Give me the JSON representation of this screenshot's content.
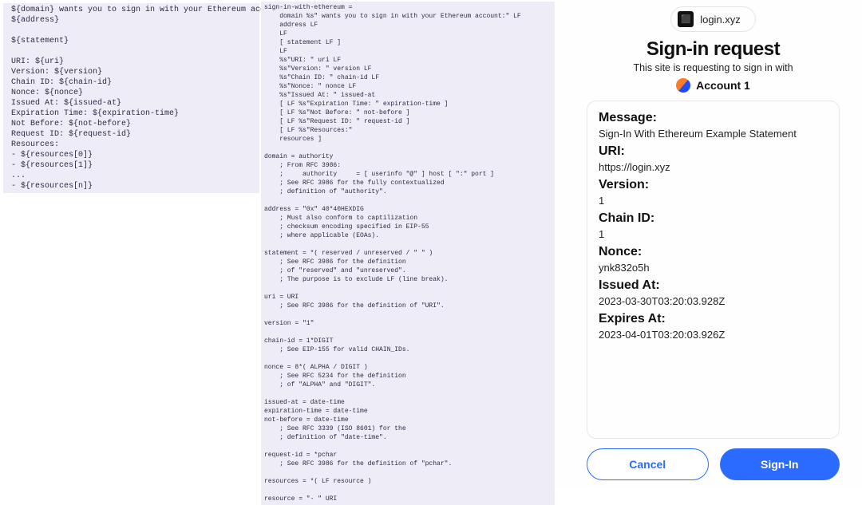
{
  "template": {
    "text": " ${domain} wants you to sign in with your Ethereum account:\n ${address}\n\n ${statement}\n\n URI: ${uri}\n Version: ${version}\n Chain ID: ${chain-id}\n Nonce: ${nonce}\n Issued At: ${issued-at}\n Expiration Time: ${expiration-time}\n Not Before: ${not-before}\n Request ID: ${request-id}\n Resources:\n - ${resources[0]}\n - ${resources[1]}\n ...\n - ${resources[n]}"
  },
  "abnf": {
    "text": "sign-in-with-ethereum =\n    domain %s\" wants you to sign in with your Ethereum account:\" LF\n    address LF\n    LF\n    [ statement LF ]\n    LF\n    %s\"URI: \" uri LF\n    %s\"Version: \" version LF\n    %s\"Chain ID: \" chain-id LF\n    %s\"Nonce: \" nonce LF\n    %s\"Issued At: \" issued-at\n    [ LF %s\"Expiration Time: \" expiration-time ]\n    [ LF %s\"Not Before: \" not-before ]\n    [ LF %s\"Request ID: \" request-id ]\n    [ LF %s\"Resources:\"\n    resources ]\n\ndomain = authority\n    ; From RFC 3986:\n    ;     authority     = [ userinfo \"@\" ] host [ \":\" port ]\n    ; See RFC 3986 for the fully contextualized\n    ; definition of \"authority\".\n\naddress = \"0x\" 40*40HEXDIG\n    ; Must also conform to captilization\n    ; checksum encoding specified in EIP-55\n    ; where applicable (EOAs).\n\nstatement = *( reserved / unreserved / \" \" )\n    ; See RFC 3986 for the definition\n    ; of \"reserved\" and \"unreserved\".\n    ; The purpose is to exclude LF (line break).\n\nuri = URI\n    ; See RFC 3986 for the definition of \"URI\".\n\nversion = \"1\"\n\nchain-id = 1*DIGIT\n    ; See EIP-155 for valid CHAIN_IDs.\n\nnonce = 8*( ALPHA / DIGIT )\n    ; See RFC 5234 for the definition\n    ; of \"ALPHA\" and \"DIGIT\".\n\nissued-at = date-time\nexpiration-time = date-time\nnot-before = date-time\n    ; See RFC 3339 (ISO 8601) for the\n    ; definition of \"date-time\".\n\nrequest-id = *pchar\n    ; See RFC 3986 for the definition of \"pchar\".\n\nresources = *( LF resource )\n\nresource = \"- \" URI"
  },
  "prompt": {
    "domain": "login.xyz",
    "title": "Sign-in request",
    "subtitle": "This site is requesting to sign in with",
    "account": "Account 1",
    "fields": {
      "message_label": "Message:",
      "message_value": "Sign-In With Ethereum Example Statement",
      "uri_label": "URI:",
      "uri_value": "https://login.xyz",
      "version_label": "Version:",
      "version_value": "1",
      "chain_label": "Chain ID:",
      "chain_value": "1",
      "nonce_label": "Nonce:",
      "nonce_value": "ynk832o5h",
      "issued_label": "Issued At:",
      "issued_value": "2023-03-30T03:20:03.928Z",
      "expires_label": "Expires At:",
      "expires_value": "2023-04-01T03:20:03.926Z"
    },
    "buttons": {
      "cancel": "Cancel",
      "signin": "Sign-In"
    }
  }
}
